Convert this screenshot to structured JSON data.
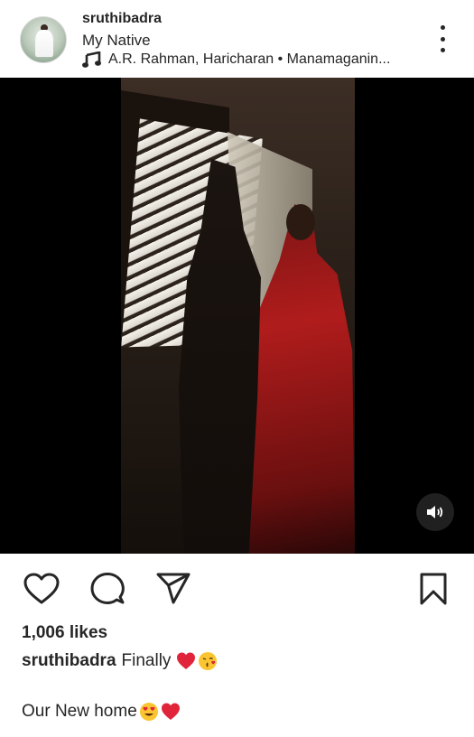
{
  "post": {
    "username": "sruthibadra",
    "location": "My Native",
    "music": "A.R. Rahman, Haricharan • Manamaganin...",
    "likes": "1,006 likes",
    "caption_user": "sruthibadra",
    "caption_text": "Finally",
    "caption_line2": "Our New home"
  },
  "icons": {
    "more": "more-options-icon",
    "music": "music-note-icon",
    "sound": "volume-icon",
    "like": "heart-icon",
    "comment": "comment-icon",
    "share": "send-icon",
    "save": "bookmark-icon"
  },
  "colors": {
    "text": "#262626",
    "background": "#ffffff",
    "heart_emoji": "#e0243a"
  }
}
